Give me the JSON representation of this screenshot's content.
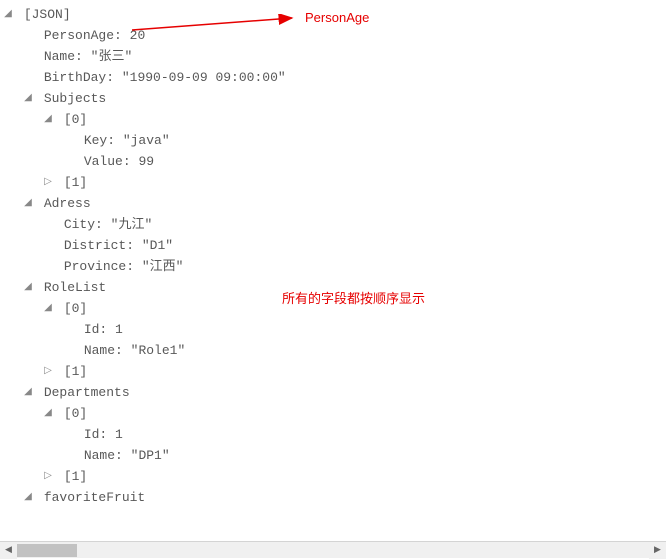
{
  "root_label": "[JSON]",
  "props": {
    "personAge": {
      "key": "PersonAge",
      "value": "20"
    },
    "name": {
      "key": "Name",
      "value": "\"张三\""
    },
    "birthDay": {
      "key": "BirthDay",
      "value": "\"1990-09-09 09:00:00\""
    }
  },
  "subjects": {
    "label": "Subjects",
    "idx0": "[0]",
    "item0": {
      "key": "Key",
      "keyVal": "\"java\"",
      "val": "Value",
      "valVal": "99"
    },
    "idx1": "[1]"
  },
  "address": {
    "label": "Adress",
    "city": {
      "key": "City",
      "value": "\"九江\""
    },
    "district": {
      "key": "District",
      "value": "\"D1\""
    },
    "province": {
      "key": "Province",
      "value": "\"江西\""
    }
  },
  "roleList": {
    "label": "RoleList",
    "idx0": "[0]",
    "item0": {
      "id": "Id",
      "idVal": "1",
      "name": "Name",
      "nameVal": "\"Role1\""
    },
    "idx1": "[1]"
  },
  "departments": {
    "label": "Departments",
    "idx0": "[0]",
    "item0": {
      "id": "Id",
      "idVal": "1",
      "name": "Name",
      "nameVal": "\"DP1\""
    },
    "idx1": "[1]"
  },
  "favoriteFruit": {
    "label": "favoriteFruit"
  },
  "annotations": {
    "personAgeLabel": "PersonAge",
    "sortNote": "所有的字段都按顺序显示"
  },
  "glyphs": {
    "down": "◢",
    "right": "▷",
    "scrollLeft": "◀",
    "scrollRight": "▶"
  }
}
